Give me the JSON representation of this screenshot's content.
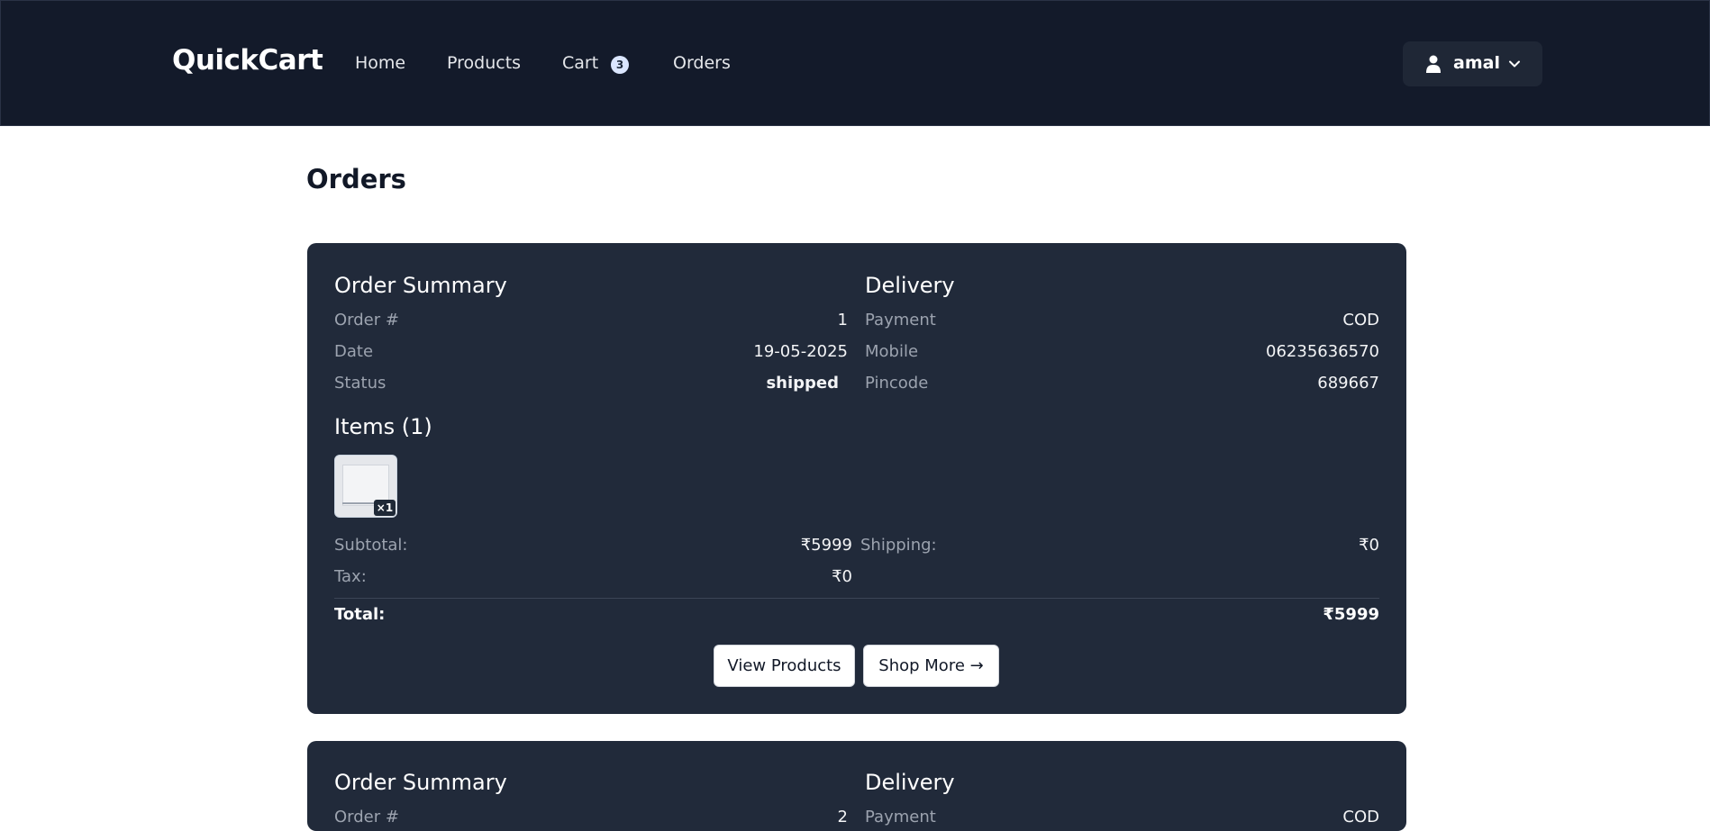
{
  "nav": {
    "brand": "QuickCart",
    "links": [
      "Home",
      "Products",
      "Cart",
      "Orders"
    ],
    "cart_count": "3",
    "user_name": "amal"
  },
  "page": {
    "title": "Orders"
  },
  "orders": [
    {
      "summary_title": "Order Summary",
      "delivery_title": "Delivery",
      "order_label": "Order #",
      "order_value": "1",
      "date_label": "Date",
      "date_value": "19-05-2025",
      "status_label": "Status",
      "status_value": "shipped",
      "payment_label": "Payment",
      "payment_value": "COD",
      "mobile_label": "Mobile",
      "mobile_value": "06235636570",
      "pincode_label": "Pincode",
      "pincode_value": "689667",
      "items_title": "Items (1)",
      "item_qty": "×1",
      "subtotal_label": "Subtotal:",
      "subtotal_value": "₹5999",
      "shipping_label": "Shipping:",
      "shipping_value": "₹0",
      "tax_label": "Tax:",
      "tax_value": "₹0",
      "total_label": "Total:",
      "total_value": "₹5999",
      "view_products_label": "View Products",
      "shop_more_label": "Shop More →"
    },
    {
      "summary_title": "Order Summary",
      "delivery_title": "Delivery",
      "order_label": "Order #",
      "order_value": "2",
      "payment_label": "Payment",
      "payment_value": "COD"
    }
  ],
  "colors": {
    "navbar": "#131a2a",
    "card": "#212a3a",
    "badge": "#dbe6ff"
  }
}
